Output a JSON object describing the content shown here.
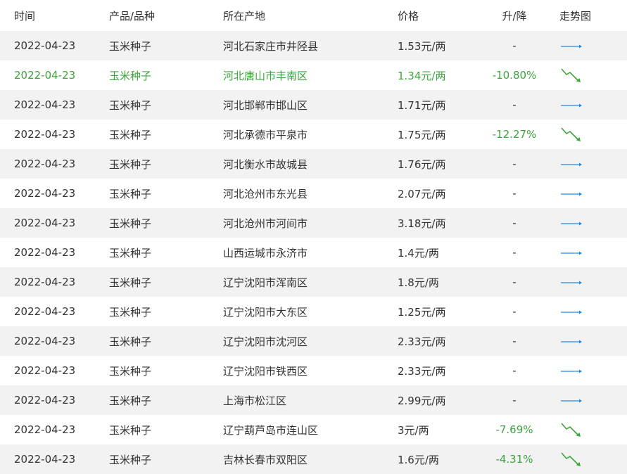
{
  "headers": {
    "date": "时间",
    "product": "产品/品种",
    "location": "所在产地",
    "price": "价格",
    "change": "升/降",
    "trend": "走势图"
  },
  "colors": {
    "flat_arrow": "#1e88e5",
    "down_arrow": "#3da33d",
    "highlight_text": "#3da33d",
    "stripe": "#f2f2f2"
  },
  "rows": [
    {
      "date": "2022-04-23",
      "product": "玉米种子",
      "location": "河北石家庄市井陉县",
      "price": "1.53元/两",
      "change": "-",
      "trend": "flat-arrow-icon"
    },
    {
      "date": "2022-04-23",
      "product": "玉米种子",
      "location": "河北唐山市丰南区",
      "price": "1.34元/两",
      "change": "-10.80%",
      "trend": "down-arrow-icon"
    },
    {
      "date": "2022-04-23",
      "product": "玉米种子",
      "location": "河北邯郸市邯山区",
      "price": "1.71元/两",
      "change": "-",
      "trend": "flat-arrow-icon"
    },
    {
      "date": "2022-04-23",
      "product": "玉米种子",
      "location": "河北承德市平泉市",
      "price": "1.75元/两",
      "change": "-12.27%",
      "trend": "down-arrow-icon"
    },
    {
      "date": "2022-04-23",
      "product": "玉米种子",
      "location": "河北衡水市故城县",
      "price": "1.76元/两",
      "change": "-",
      "trend": "flat-arrow-icon"
    },
    {
      "date": "2022-04-23",
      "product": "玉米种子",
      "location": "河北沧州市东光县",
      "price": "2.07元/两",
      "change": "-",
      "trend": "flat-arrow-icon"
    },
    {
      "date": "2022-04-23",
      "product": "玉米种子",
      "location": "河北沧州市河间市",
      "price": "3.18元/两",
      "change": "-",
      "trend": "flat-arrow-icon"
    },
    {
      "date": "2022-04-23",
      "product": "玉米种子",
      "location": "山西运城市永济市",
      "price": "1.4元/两",
      "change": "-",
      "trend": "flat-arrow-icon"
    },
    {
      "date": "2022-04-23",
      "product": "玉米种子",
      "location": "辽宁沈阳市浑南区",
      "price": "1.8元/两",
      "change": "-",
      "trend": "flat-arrow-icon"
    },
    {
      "date": "2022-04-23",
      "product": "玉米种子",
      "location": "辽宁沈阳市大东区",
      "price": "1.25元/两",
      "change": "-",
      "trend": "flat-arrow-icon"
    },
    {
      "date": "2022-04-23",
      "product": "玉米种子",
      "location": "辽宁沈阳市沈河区",
      "price": "2.33元/两",
      "change": "-",
      "trend": "flat-arrow-icon"
    },
    {
      "date": "2022-04-23",
      "product": "玉米种子",
      "location": "辽宁沈阳市铁西区",
      "price": "2.33元/两",
      "change": "-",
      "trend": "flat-arrow-icon"
    },
    {
      "date": "2022-04-23",
      "product": "玉米种子",
      "location": "上海市松江区",
      "price": "2.99元/两",
      "change": "-",
      "trend": "flat-arrow-icon"
    },
    {
      "date": "2022-04-23",
      "product": "玉米种子",
      "location": "辽宁葫芦岛市连山区",
      "price": "3元/两",
      "change": "-7.69%",
      "trend": "down-arrow-icon"
    },
    {
      "date": "2022-04-23",
      "product": "玉米种子",
      "location": "吉林长春市双阳区",
      "price": "1.6元/两",
      "change": "-4.31%",
      "trend": "down-arrow-icon"
    }
  ],
  "highlight_row_index": 1
}
